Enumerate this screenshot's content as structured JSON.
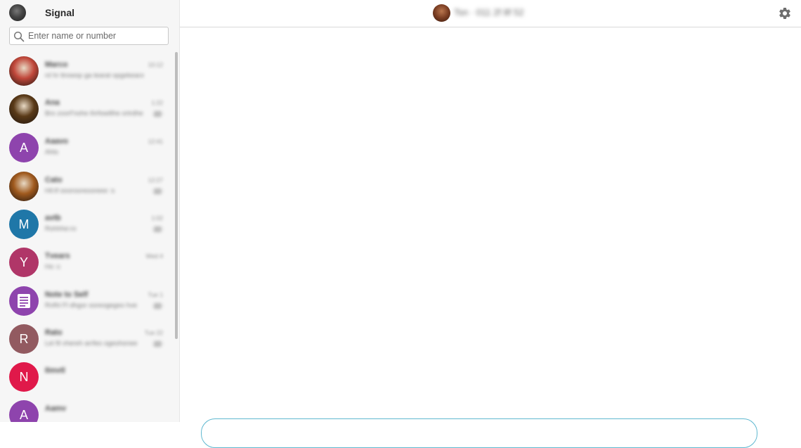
{
  "app": {
    "title": "Signal"
  },
  "search": {
    "placeholder": "Enter name or number"
  },
  "conversations": [
    {
      "name": "Marco",
      "preview": "rd hr ttrowop ga tearat opgekeara",
      "time": "10:12",
      "badge": "",
      "avatar": {
        "type": "photo",
        "letter": "",
        "color": "#c0473a"
      }
    },
    {
      "name": "Ana",
      "preview": "Bro zoorf'nohe thrfowillhe ortrdhe",
      "time": "1:22",
      "badge": "22",
      "avatar": {
        "type": "photo",
        "letter": "",
        "color": "#5a3a18"
      }
    },
    {
      "name": "Aaavo",
      "preview": "Ahts",
      "time": "12:41",
      "badge": "",
      "avatar": {
        "type": "letter",
        "letter": "A",
        "color": "#8e44ad"
      }
    },
    {
      "name": "Cato",
      "preview": "Hil:tf ooorooreooreee :s",
      "time": "12:27",
      "badge": "22",
      "avatar": {
        "type": "photo",
        "letter": "",
        "color": "#a05a1e"
      }
    },
    {
      "name": "avtb",
      "preview": "Rohhhe:ro",
      "time": "1:02",
      "badge": "22",
      "avatar": {
        "type": "letter",
        "letter": "M",
        "color": "#1f77a8"
      }
    },
    {
      "name": "Tvears",
      "preview": "Ho :c",
      "time": "Wed 4",
      "badge": "",
      "avatar": {
        "type": "letter",
        "letter": "Y",
        "color": "#b03668"
      }
    },
    {
      "name": "Note to Self",
      "preview": "Rnfhl Fl dhgor ooreogegeo hve",
      "time": "Tue 1",
      "badge": "22",
      "avatar": {
        "type": "note",
        "letter": "",
        "color": "#8e44ad"
      }
    },
    {
      "name": "Rato",
      "preview": "Lel fil vhereh arrfeo ogeohonee",
      "time": "Tue 22",
      "badge": "22",
      "avatar": {
        "type": "letter",
        "letter": "R",
        "color": "#925a60"
      }
    },
    {
      "name": "Ilmvtl",
      "preview": "",
      "time": "",
      "badge": "",
      "avatar": {
        "type": "letter",
        "letter": "N",
        "color": "#e0194a"
      }
    },
    {
      "name": "Aamv",
      "preview": "",
      "time": "",
      "badge": "",
      "avatar": {
        "type": "letter",
        "letter": "A",
        "color": "#8e44ad"
      }
    }
  ],
  "conversation_header": {
    "title": "Tsn · 011 2f 8f 52"
  },
  "icons": {
    "settings": "gear-icon",
    "search": "search-icon",
    "note": "note-icon"
  },
  "colors": {
    "accent": "#5fb8d0",
    "sidebar_bg": "#f6f6f6"
  }
}
